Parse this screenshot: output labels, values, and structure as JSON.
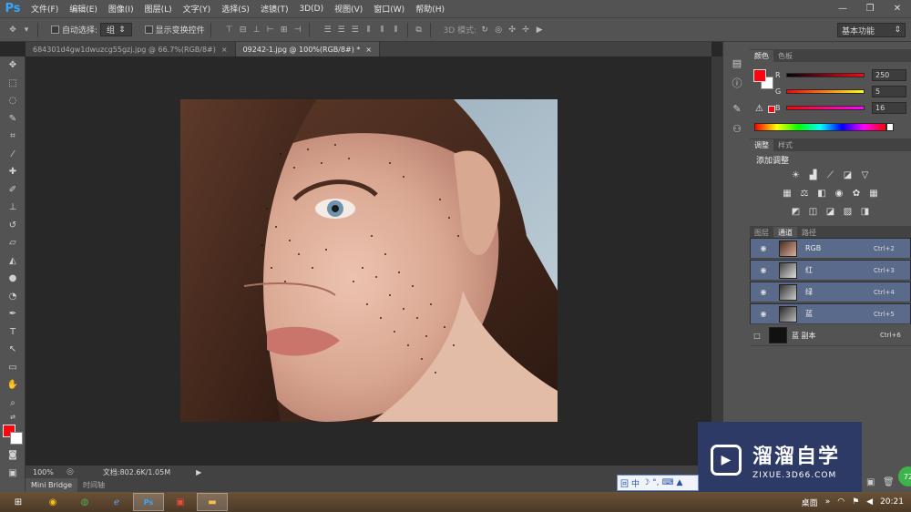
{
  "app": {
    "logo": "Ps"
  },
  "menu": [
    "文件(F)",
    "编辑(E)",
    "图像(I)",
    "图层(L)",
    "文字(Y)",
    "选择(S)",
    "滤镜(T)",
    "3D(D)",
    "视图(V)",
    "窗口(W)",
    "帮助(H)"
  ],
  "window_controls": {
    "minimize": "—",
    "restore": "❐",
    "close": "✕"
  },
  "options": {
    "auto_select_label": "自动选择:",
    "auto_select_value": "组",
    "show_transform_label": "显示变换控件",
    "mode_3d_label": "3D 模式:",
    "workspace": "基本功能"
  },
  "doc_tabs": [
    {
      "title": "684301d4gw1dwuzcg55gzj.jpg @ 66.7%(RGB/8#)",
      "close": "×",
      "active": false
    },
    {
      "title": "09242-1.jpg @ 100%(RGB/8#) *",
      "close": "×",
      "active": true
    }
  ],
  "status": {
    "zoom": "100%",
    "doc_info": "文档:802.6K/1.05M"
  },
  "bottom_tabs": [
    "Mini Bridge",
    "时间轴"
  ],
  "color_panel": {
    "tabs": [
      "颜色",
      "色板"
    ],
    "r_label": "R",
    "r_value": "250",
    "g_label": "G",
    "g_value": "5",
    "b_label": "B",
    "b_value": "16",
    "foreground": "#fa0510"
  },
  "adjust_panel": {
    "tabs": [
      "调整",
      "样式"
    ],
    "title": "添加调整"
  },
  "channels_panel": {
    "tabs": [
      "图层",
      "通道",
      "路径"
    ],
    "channels": [
      {
        "name": "RGB",
        "key": "Ctrl+2",
        "selected": true
      },
      {
        "name": "红",
        "key": "Ctrl+3",
        "selected": true
      },
      {
        "name": "绿",
        "key": "Ctrl+4",
        "selected": true
      },
      {
        "name": "蓝",
        "key": "Ctrl+5",
        "selected": true
      },
      {
        "name": "蓝 副本",
        "key": "Ctrl+6",
        "selected": false
      }
    ]
  },
  "watermark": {
    "title": "溜溜自学",
    "subtitle": "ZIXUE.3D66.COM"
  },
  "ime": {
    "lang": "中"
  },
  "taskbar": {
    "desktop_label": "桌面",
    "time": "20:21",
    "badge": "72"
  }
}
